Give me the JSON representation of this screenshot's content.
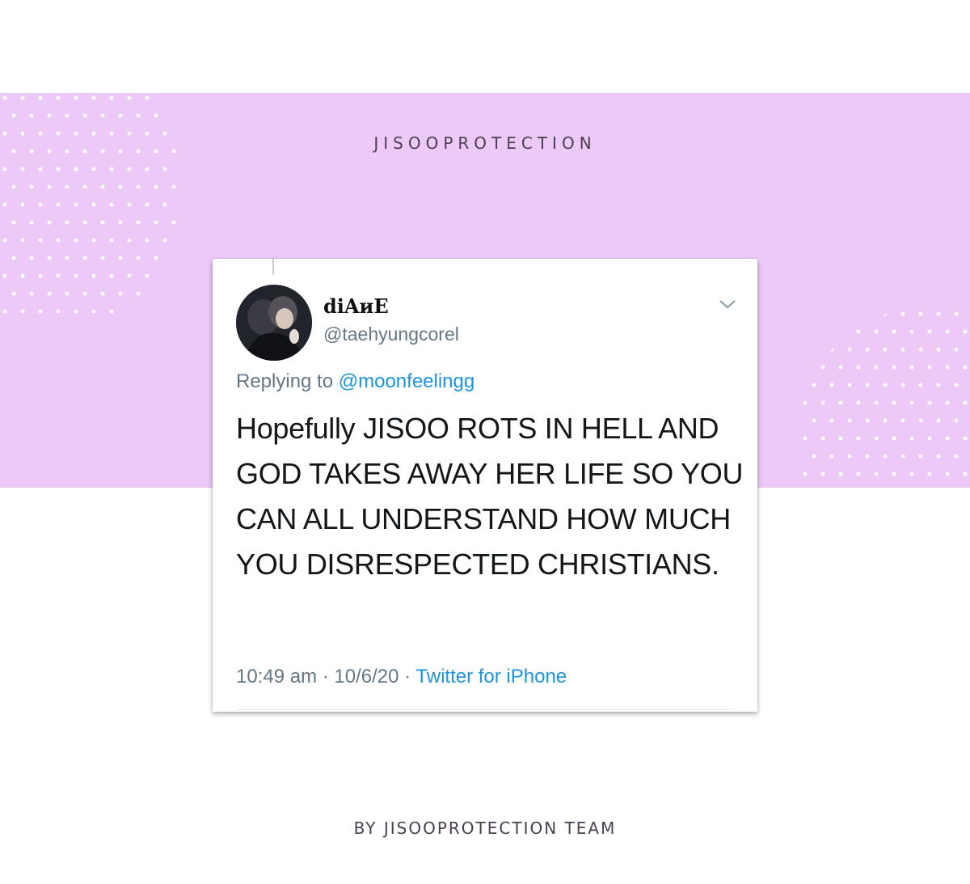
{
  "graphic": {
    "brand": "JISOOPROTECTION",
    "footer": "BY JISOOPROTECTION TEAM",
    "band_color": "#ecc9f7",
    "dot_color": "#ffffff"
  },
  "tweet": {
    "display_name": "diAиE",
    "handle": "@taehyungcorel",
    "replying_prefix": "Replying to",
    "replying_to": "@moonfeelingg",
    "text": "Hopefully JISOO ROTS IN HELL AND GOD TAKES AWAY HER LIFE SO YOU CAN ALL UNDERSTAND HOW MUCH YOU DISRESPECTED CHRISTIANS.",
    "time": "10:49 am",
    "date": "10/6/20",
    "separator": "·",
    "source": "Twitter for iPhone",
    "menu_icon": "chevron-down-icon",
    "link_color": "#1b95e0"
  }
}
